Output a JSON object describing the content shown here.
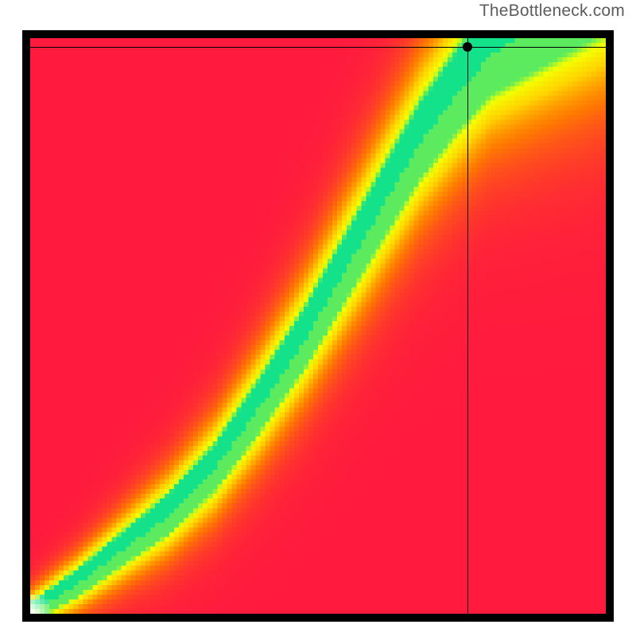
{
  "attribution": "TheBottleneck.com",
  "chart_data": {
    "type": "heatmap",
    "title": "",
    "xlabel": "",
    "ylabel": "",
    "x_range": [
      0,
      1
    ],
    "y_range": [
      0,
      1
    ],
    "optimal_curve_points": [
      [
        0.0,
        0.0
      ],
      [
        0.08,
        0.05
      ],
      [
        0.16,
        0.11
      ],
      [
        0.24,
        0.17
      ],
      [
        0.32,
        0.25
      ],
      [
        0.4,
        0.36
      ],
      [
        0.48,
        0.48
      ],
      [
        0.55,
        0.6
      ],
      [
        0.62,
        0.72
      ],
      [
        0.68,
        0.82
      ],
      [
        0.74,
        0.9
      ],
      [
        0.8,
        0.97
      ],
      [
        0.85,
        1.0
      ]
    ],
    "marker": {
      "x": 0.76,
      "y": 0.985
    },
    "color_scale": [
      "#ff1a3e",
      "#ff7a00",
      "#ffd400",
      "#f4ff00",
      "#14e28a"
    ]
  },
  "labels": {
    "heatmap": "bottleneck-heatmap",
    "marker": "selected-point-marker",
    "crosshair_v": "crosshair-vertical",
    "crosshair_h": "crosshair-horizontal"
  }
}
